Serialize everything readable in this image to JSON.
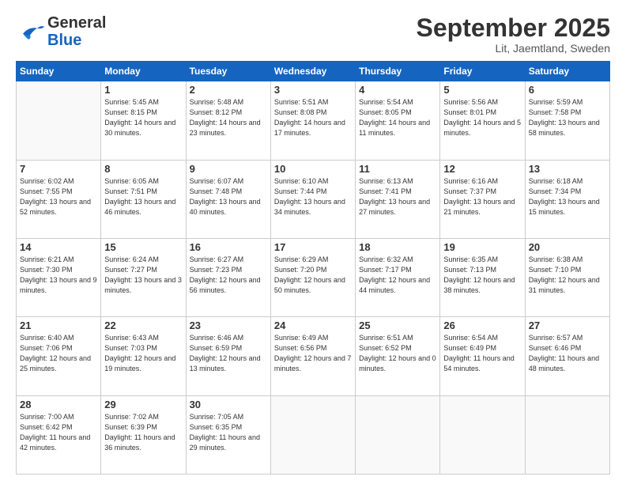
{
  "header": {
    "logo_line1": "General",
    "logo_line2": "Blue",
    "title": "September 2025",
    "subtitle": "Lit, Jaemtland, Sweden"
  },
  "days_of_week": [
    "Sunday",
    "Monday",
    "Tuesday",
    "Wednesday",
    "Thursday",
    "Friday",
    "Saturday"
  ],
  "weeks": [
    [
      {
        "num": "",
        "empty": true
      },
      {
        "num": "1",
        "sunrise": "5:45 AM",
        "sunset": "8:15 PM",
        "daylight": "14 hours and 30 minutes."
      },
      {
        "num": "2",
        "sunrise": "5:48 AM",
        "sunset": "8:12 PM",
        "daylight": "14 hours and 23 minutes."
      },
      {
        "num": "3",
        "sunrise": "5:51 AM",
        "sunset": "8:08 PM",
        "daylight": "14 hours and 17 minutes."
      },
      {
        "num": "4",
        "sunrise": "5:54 AM",
        "sunset": "8:05 PM",
        "daylight": "14 hours and 11 minutes."
      },
      {
        "num": "5",
        "sunrise": "5:56 AM",
        "sunset": "8:01 PM",
        "daylight": "14 hours and 5 minutes."
      },
      {
        "num": "6",
        "sunrise": "5:59 AM",
        "sunset": "7:58 PM",
        "daylight": "13 hours and 58 minutes."
      }
    ],
    [
      {
        "num": "7",
        "sunrise": "6:02 AM",
        "sunset": "7:55 PM",
        "daylight": "13 hours and 52 minutes."
      },
      {
        "num": "8",
        "sunrise": "6:05 AM",
        "sunset": "7:51 PM",
        "daylight": "13 hours and 46 minutes."
      },
      {
        "num": "9",
        "sunrise": "6:07 AM",
        "sunset": "7:48 PM",
        "daylight": "13 hours and 40 minutes."
      },
      {
        "num": "10",
        "sunrise": "6:10 AM",
        "sunset": "7:44 PM",
        "daylight": "13 hours and 34 minutes."
      },
      {
        "num": "11",
        "sunrise": "6:13 AM",
        "sunset": "7:41 PM",
        "daylight": "13 hours and 27 minutes."
      },
      {
        "num": "12",
        "sunrise": "6:16 AM",
        "sunset": "7:37 PM",
        "daylight": "13 hours and 21 minutes."
      },
      {
        "num": "13",
        "sunrise": "6:18 AM",
        "sunset": "7:34 PM",
        "daylight": "13 hours and 15 minutes."
      }
    ],
    [
      {
        "num": "14",
        "sunrise": "6:21 AM",
        "sunset": "7:30 PM",
        "daylight": "13 hours and 9 minutes."
      },
      {
        "num": "15",
        "sunrise": "6:24 AM",
        "sunset": "7:27 PM",
        "daylight": "13 hours and 3 minutes."
      },
      {
        "num": "16",
        "sunrise": "6:27 AM",
        "sunset": "7:23 PM",
        "daylight": "12 hours and 56 minutes."
      },
      {
        "num": "17",
        "sunrise": "6:29 AM",
        "sunset": "7:20 PM",
        "daylight": "12 hours and 50 minutes."
      },
      {
        "num": "18",
        "sunrise": "6:32 AM",
        "sunset": "7:17 PM",
        "daylight": "12 hours and 44 minutes."
      },
      {
        "num": "19",
        "sunrise": "6:35 AM",
        "sunset": "7:13 PM",
        "daylight": "12 hours and 38 minutes."
      },
      {
        "num": "20",
        "sunrise": "6:38 AM",
        "sunset": "7:10 PM",
        "daylight": "12 hours and 31 minutes."
      }
    ],
    [
      {
        "num": "21",
        "sunrise": "6:40 AM",
        "sunset": "7:06 PM",
        "daylight": "12 hours and 25 minutes."
      },
      {
        "num": "22",
        "sunrise": "6:43 AM",
        "sunset": "7:03 PM",
        "daylight": "12 hours and 19 minutes."
      },
      {
        "num": "23",
        "sunrise": "6:46 AM",
        "sunset": "6:59 PM",
        "daylight": "12 hours and 13 minutes."
      },
      {
        "num": "24",
        "sunrise": "6:49 AM",
        "sunset": "6:56 PM",
        "daylight": "12 hours and 7 minutes."
      },
      {
        "num": "25",
        "sunrise": "6:51 AM",
        "sunset": "6:52 PM",
        "daylight": "12 hours and 0 minutes."
      },
      {
        "num": "26",
        "sunrise": "6:54 AM",
        "sunset": "6:49 PM",
        "daylight": "11 hours and 54 minutes."
      },
      {
        "num": "27",
        "sunrise": "6:57 AM",
        "sunset": "6:46 PM",
        "daylight": "11 hours and 48 minutes."
      }
    ],
    [
      {
        "num": "28",
        "sunrise": "7:00 AM",
        "sunset": "6:42 PM",
        "daylight": "11 hours and 42 minutes."
      },
      {
        "num": "29",
        "sunrise": "7:02 AM",
        "sunset": "6:39 PM",
        "daylight": "11 hours and 36 minutes."
      },
      {
        "num": "30",
        "sunrise": "7:05 AM",
        "sunset": "6:35 PM",
        "daylight": "11 hours and 29 minutes."
      },
      {
        "num": "",
        "empty": true
      },
      {
        "num": "",
        "empty": true
      },
      {
        "num": "",
        "empty": true
      },
      {
        "num": "",
        "empty": true
      }
    ]
  ]
}
